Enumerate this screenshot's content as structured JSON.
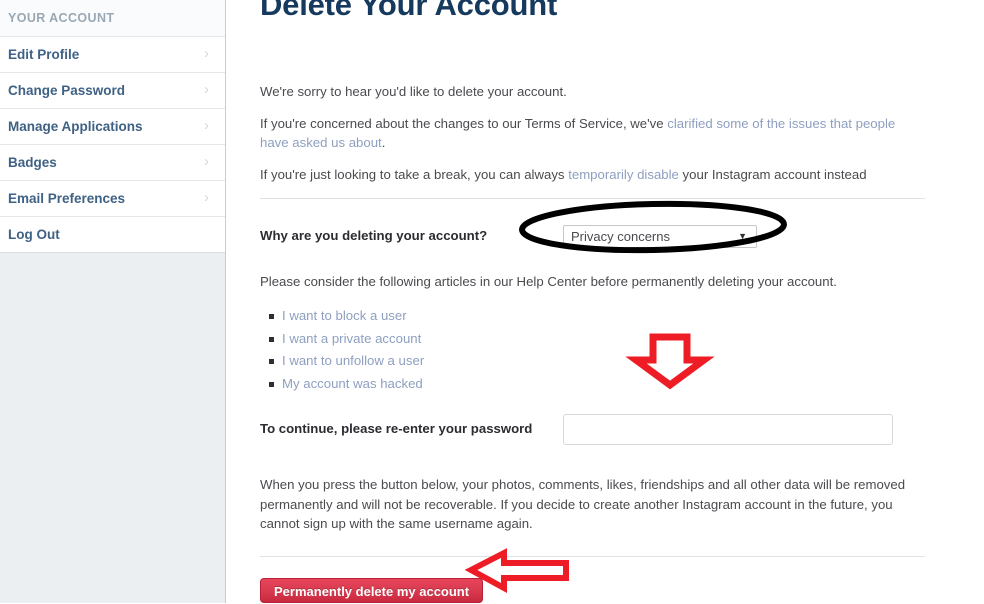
{
  "sidebar": {
    "header": "YOUR ACCOUNT",
    "items": [
      {
        "label": "Edit Profile",
        "chevron": "chevron-right-icon",
        "has_chevron": true
      },
      {
        "label": "Change Password",
        "chevron": "chevron-right-icon",
        "has_chevron": true
      },
      {
        "label": "Manage Applications",
        "chevron": "chevron-right-icon",
        "has_chevron": true
      },
      {
        "label": "Badges",
        "chevron": "chevron-right-icon",
        "has_chevron": true
      },
      {
        "label": "Email Preferences",
        "chevron": "chevron-right-icon",
        "has_chevron": true
      },
      {
        "label": "Log Out",
        "chevron": "",
        "has_chevron": false
      }
    ]
  },
  "main": {
    "title": "Delete Your Account",
    "intro": {
      "line1": "We're sorry to hear you'd like to delete your account.",
      "line2_prefix": "If you're concerned about the changes to our Terms of Service, we've ",
      "line2_link": "clarified some of the issues that people have asked us about",
      "line2_suffix": ".",
      "line3_prefix": "If you're just looking to take a break, you can always ",
      "line3_link": "temporarily disable",
      "line3_suffix": " your Instagram account instead"
    },
    "reason": {
      "label": "Why are you deleting your account?",
      "selected": "Privacy concerns",
      "caret": "▼"
    },
    "help_text": "Please consider the following articles in our Help Center before permanently deleting your account.",
    "articles": [
      "I want to block a user",
      "I want a private account",
      "I want to unfollow a user",
      "My account was hacked"
    ],
    "password": {
      "label": "To continue, please re-enter your password",
      "value": "",
      "placeholder": ""
    },
    "warning": "When you press the button below, your photos, comments, likes, friendships and all other data will be removed permanently and will not be recoverable. If you decide to create another Instagram account in the future, you cannot sign up with the same username again.",
    "delete_button": "Permanently delete my account"
  },
  "annotations": {
    "ellipse_around_select": "black-ellipse-annotation",
    "arrow_to_password": "red-down-arrow-annotation",
    "arrow_to_delete_button": "red-left-arrow-annotation",
    "colors": {
      "annotation_red": "#ee1c25",
      "annotation_black": "#000000"
    }
  }
}
